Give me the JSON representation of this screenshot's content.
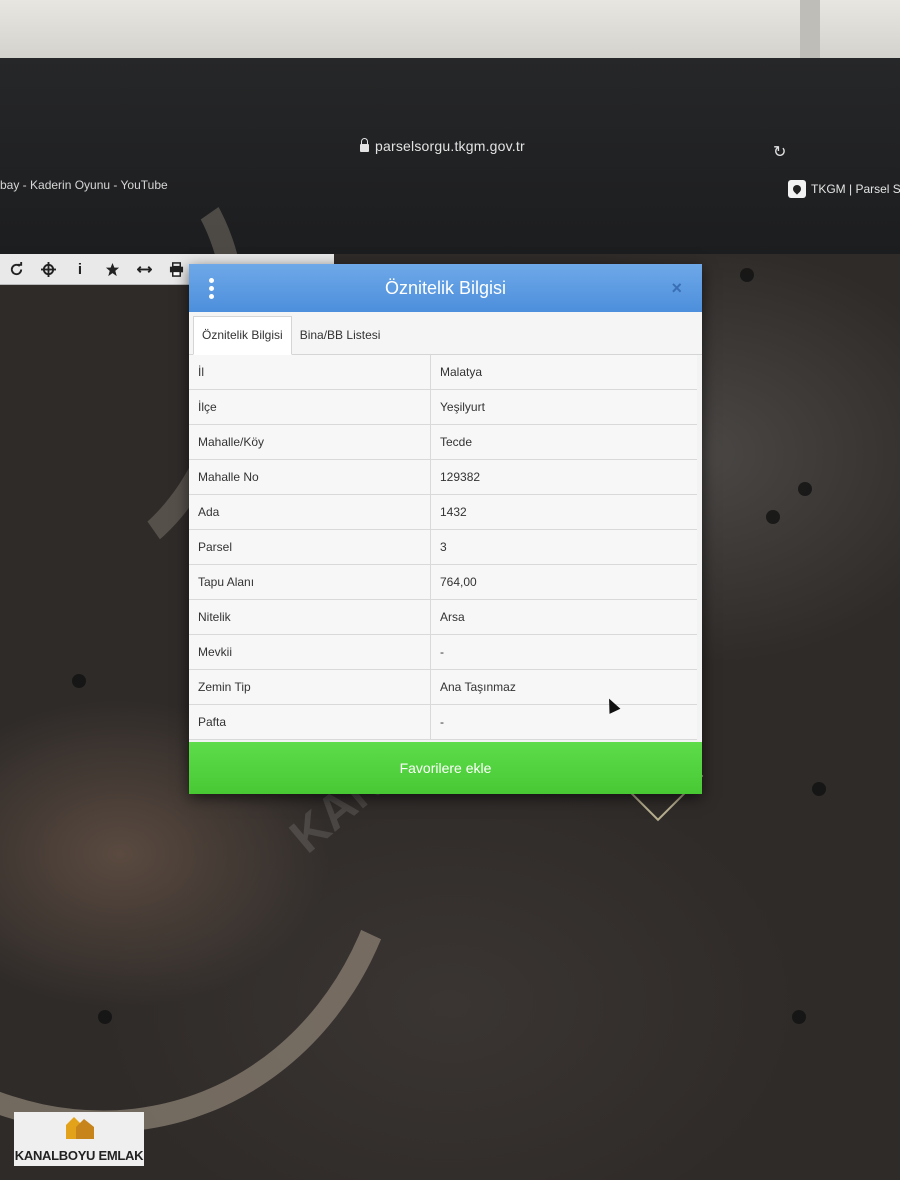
{
  "browser": {
    "url": "parselsorgu.tkgm.gov.tr",
    "bookmark_left": "bay - Kaderin Oyunu - YouTube",
    "bookmark_right": "TKGM | Parsel So"
  },
  "map_toolbar": {
    "icons": [
      "refresh-icon",
      "crosshair-icon",
      "info-icon",
      "star-icon",
      "measure-icon",
      "print-icon"
    ],
    "info_glyph": "i"
  },
  "dialog": {
    "title": "Öznitelik Bilgisi",
    "close_glyph": "×",
    "tabs": [
      {
        "label": "Öznitelik Bilgisi",
        "active": true
      },
      {
        "label": "Bina/BB Listesi",
        "active": false
      }
    ],
    "rows": [
      {
        "key": "İl",
        "value": "Malatya"
      },
      {
        "key": "İlçe",
        "value": "Yeşilyurt"
      },
      {
        "key": "Mahalle/Köy",
        "value": "Tecde"
      },
      {
        "key": "Mahalle No",
        "value": "129382"
      },
      {
        "key": "Ada",
        "value": "1432"
      },
      {
        "key": "Parsel",
        "value": "3"
      },
      {
        "key": "Tapu Alanı",
        "value": "764,00"
      },
      {
        "key": "Nitelik",
        "value": "Arsa"
      },
      {
        "key": "Mevkii",
        "value": "-"
      },
      {
        "key": "Zemin Tip",
        "value": "Ana Taşınmaz"
      },
      {
        "key": "Pafta",
        "value": "-"
      }
    ],
    "favorite_button": "Favorilere ekle"
  },
  "watermark": "KANALBOYU EMLAK",
  "logo": {
    "text": "KANALBOYU EMLAK"
  },
  "colors": {
    "header_blue": "#4d8fdc",
    "button_green": "#48c934"
  }
}
